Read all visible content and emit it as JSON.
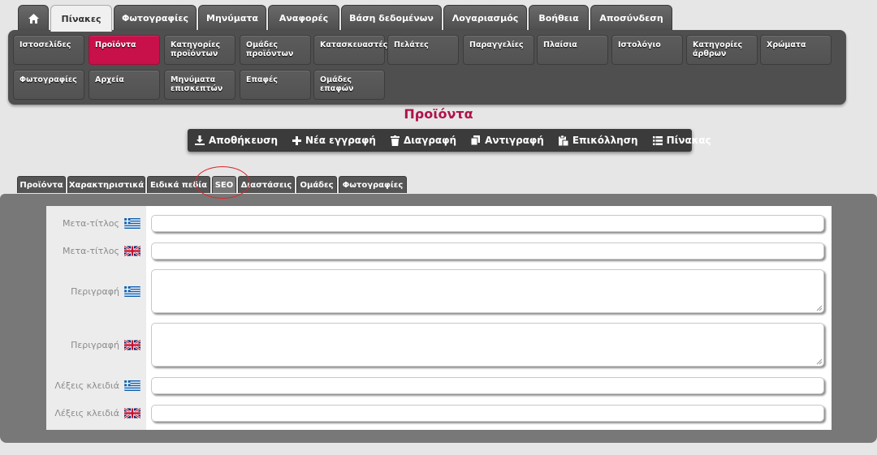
{
  "top_tabs": [
    {
      "name": "home",
      "label": "",
      "icon": "home-icon"
    },
    {
      "name": "pinakes",
      "label": "Πίνακες",
      "active": true
    },
    {
      "name": "fotografies",
      "label": "Φωτογραφίες"
    },
    {
      "name": "minymata",
      "label": "Μηνύματα"
    },
    {
      "name": "anafores",
      "label": "Αναφορές"
    },
    {
      "name": "vasi-dedomenon",
      "label": "Βάση δεδομένων"
    },
    {
      "name": "logariasmos",
      "label": "Λογαριασμός"
    },
    {
      "name": "voitheia",
      "label": "Βοήθεια"
    },
    {
      "name": "aposyndesi",
      "label": "Αποσύνδεση"
    }
  ],
  "sub_menu": [
    {
      "label": "Ιστοσελίδες"
    },
    {
      "label": "Προϊόντα",
      "active": true
    },
    {
      "label": "Κατηγορίες\nπροϊόντων"
    },
    {
      "label": "Ομάδες\nπροϊόντων"
    },
    {
      "label": "Κατασκευαστές"
    },
    {
      "label": "Πελάτες"
    },
    {
      "label": "Παραγγελίες"
    },
    {
      "label": "Πλαίσια"
    },
    {
      "label": "Ιστολόγιο"
    },
    {
      "label": "Κατηγορίες\nάρθρων"
    },
    {
      "label": "Χρώματα"
    },
    {
      "label": "Φωτογραφίες"
    },
    {
      "label": "Αρχεία"
    },
    {
      "label": "Μηνύματα\nεπισκεπτών"
    },
    {
      "label": "Επαφές"
    },
    {
      "label": "Ομάδες επαφών"
    }
  ],
  "page_title": "Προϊόντα",
  "toolbar": [
    {
      "name": "save",
      "label": "Αποθήκευση",
      "icon": "download-icon"
    },
    {
      "name": "new-record",
      "label": "Νέα εγγραφή",
      "icon": "plus-icon"
    },
    {
      "name": "delete",
      "label": "Διαγραφή",
      "icon": "trash-icon"
    },
    {
      "name": "copy",
      "label": "Αντιγραφή",
      "icon": "copy-icon"
    },
    {
      "name": "paste",
      "label": "Επικόλληση",
      "icon": "paste-icon"
    },
    {
      "name": "table",
      "label": "Πίνακας",
      "icon": "list-icon"
    }
  ],
  "content_tabs": [
    {
      "name": "proionta",
      "label": "Προϊόντα"
    },
    {
      "name": "xaraktiristika",
      "label": "Χαρακτηριστικά"
    },
    {
      "name": "eidika-pedia",
      "label": "Ειδικά πεδία"
    },
    {
      "name": "seo",
      "label": "SEO",
      "active": true
    },
    {
      "name": "diastaseis",
      "label": "Διαστάσεις"
    },
    {
      "name": "omades",
      "label": "Ομάδες"
    },
    {
      "name": "fotografies",
      "label": "Φωτογραφίες"
    }
  ],
  "form_rows": [
    {
      "name": "meta-title-el",
      "label": "Μετα-τίτλος",
      "flag": "greek-flag-icon",
      "type": "input",
      "value": ""
    },
    {
      "name": "meta-title-en",
      "label": "Μετα-τίτλος",
      "flag": "uk-flag-icon",
      "type": "input",
      "value": ""
    },
    {
      "name": "description-el",
      "label": "Περιγραφή",
      "flag": "greek-flag-icon",
      "type": "textarea",
      "value": ""
    },
    {
      "name": "description-en",
      "label": "Περιγραφή",
      "flag": "uk-flag-icon",
      "type": "textarea",
      "value": ""
    },
    {
      "name": "keywords-el",
      "label": "Λέξεις κλειδιά",
      "flag": "greek-flag-icon",
      "type": "input",
      "value": ""
    },
    {
      "name": "keywords-en",
      "label": "Λέξεις κλειδιά",
      "flag": "uk-flag-icon",
      "type": "input",
      "value": ""
    }
  ],
  "colors": {
    "accent": "#c8104a",
    "title": "#b0124a",
    "annotation": "#e0242a"
  }
}
